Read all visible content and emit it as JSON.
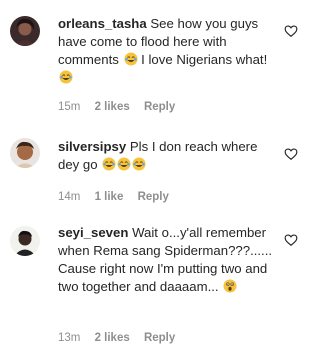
{
  "comments": [
    {
      "username": "orleans_tasha",
      "text": "See how you guys have come to flood here with comments",
      "text_after": "I love Nigerians what!",
      "time": "15m",
      "likes": "2 likes",
      "reply": "Reply",
      "emojis": [
        "tears-of-joy-emoji",
        "tears-of-joy-emoji"
      ]
    },
    {
      "username": "silversipsy",
      "text": "Pls I don reach where dey go",
      "time": "14m",
      "likes": "1 like",
      "reply": "Reply",
      "emojis": [
        "tears-of-joy-emoji",
        "tears-of-joy-emoji",
        "tears-of-joy-emoji"
      ]
    },
    {
      "username": "seyi_seven",
      "text": "Wait o...y'all remember when Rema sang Spiderman???...... Cause right now I'm putting two and two together and daaaam...",
      "time": "13m",
      "likes": "2 likes",
      "reply": "Reply",
      "emojis": [
        "astonished-face-emoji"
      ]
    }
  ],
  "colors": {
    "username": "#262626",
    "text": "#262626",
    "meta": "#8e8e8e",
    "emoji_face": "#f7c33b",
    "emoji_tear": "#5aa9e6"
  },
  "icons": {
    "like": "heart-outline-icon"
  }
}
